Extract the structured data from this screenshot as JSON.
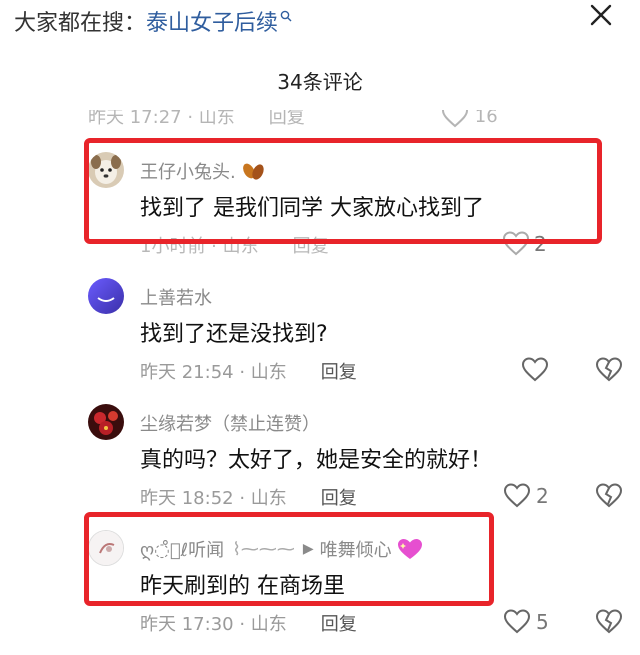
{
  "search": {
    "prefix": "大家都在搜：",
    "term": "泰山女子后续"
  },
  "header": {
    "comment_count": "34条评论"
  },
  "scrolled_meta": {
    "time": "昨天 17:27 · 山东",
    "reply": "回复",
    "likes": "16"
  },
  "comments": [
    {
      "username": "王仔小兔头.",
      "text": "找到了 是我们同学 大家放心找到了",
      "time": "1小时前 · 山东",
      "reply": "回复",
      "likes": "2"
    },
    {
      "username": "上善若水",
      "text": "找到了还是没找到?",
      "time": "昨天 21:54 · 山东",
      "reply": "回复",
      "likes": ""
    },
    {
      "username": "尘缘若梦（禁止连赞）",
      "text": "真的吗？太好了，她是安全的就好！",
      "time": "昨天 18:52 · 山东",
      "reply": "回复",
      "likes": "2"
    },
    {
      "username": "ღ◌̊⃝ℓ听闻",
      "username_mid": "▶",
      "username_tail": "唯舞倾心",
      "text": "昨天刷到的  在商场里",
      "time": "昨天 17:30 · 山东",
      "reply": "回复",
      "likes": "5"
    }
  ],
  "colors": {
    "highlight": "#e8242a",
    "link": "#2f5d9e"
  }
}
